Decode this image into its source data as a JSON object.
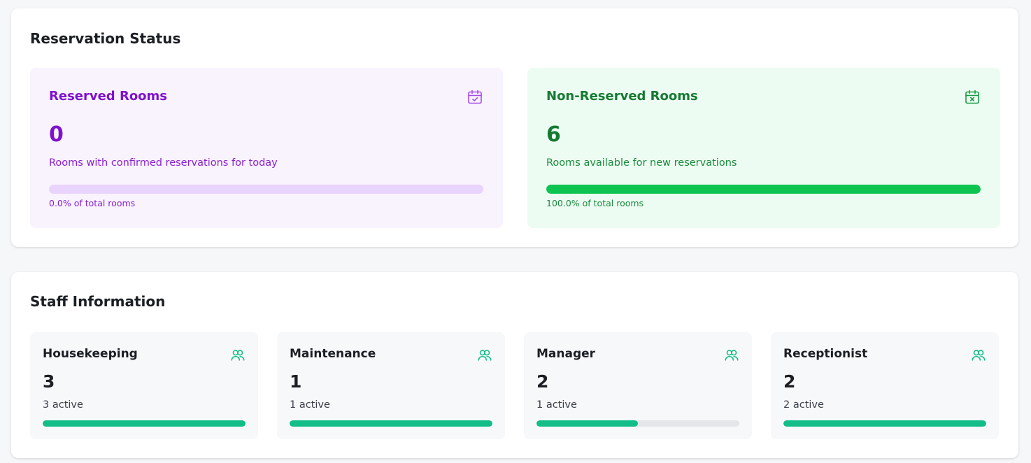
{
  "reservation": {
    "title": "Reservation Status",
    "reserved": {
      "title": "Reserved Rooms",
      "count": "0",
      "description": "Rooms with confirmed reservations for today",
      "progress": 0.0,
      "caption": "0.0% of total rooms",
      "icon": "calendar-check-icon",
      "accent": "#7e12cc"
    },
    "non_reserved": {
      "title": "Non-Reserved Rooms",
      "count": "6",
      "description": "Rooms available for new reservations",
      "progress": 1.0,
      "caption": "100.0% of total rooms",
      "icon": "calendar-x-icon",
      "accent": "#157a32"
    }
  },
  "staff": {
    "title": "Staff Information",
    "accent": "#12bd87",
    "cards": [
      {
        "role": "Housekeeping",
        "count": "3",
        "active": "3 active",
        "progress": 1.0,
        "icon": "users-icon"
      },
      {
        "role": "Maintenance",
        "count": "1",
        "active": "1 active",
        "progress": 1.0,
        "icon": "users-icon"
      },
      {
        "role": "Manager",
        "count": "2",
        "active": "1 active",
        "progress": 0.5,
        "icon": "users-icon"
      },
      {
        "role": "Receptionist",
        "count": "2",
        "active": "2 active",
        "progress": 1.0,
        "icon": "users-icon"
      }
    ]
  }
}
